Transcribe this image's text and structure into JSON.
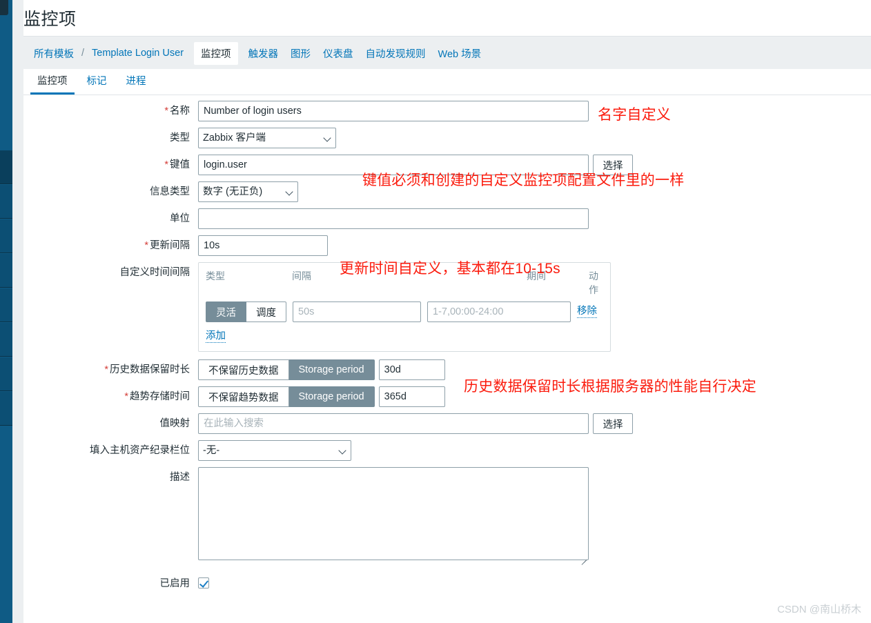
{
  "page": {
    "title": "监控项"
  },
  "breadcrumb": {
    "all_templates": "所有模板",
    "separator": "/",
    "template_name": "Template Login User",
    "tabs": [
      {
        "label": "监控项",
        "active": true
      },
      {
        "label": "触发器",
        "active": false
      },
      {
        "label": "图形",
        "active": false
      },
      {
        "label": "仪表盘",
        "active": false
      },
      {
        "label": "自动发现规则",
        "active": false
      },
      {
        "label": "Web 场景",
        "active": false
      }
    ]
  },
  "subtabs": [
    {
      "label": "监控项",
      "active": true
    },
    {
      "label": "标记",
      "active": false
    },
    {
      "label": "进程",
      "active": false
    }
  ],
  "form": {
    "name": {
      "label": "名称",
      "required": true,
      "value": "Number of login users"
    },
    "type": {
      "label": "类型",
      "required": false,
      "value": "Zabbix 客户端"
    },
    "key": {
      "label": "键值",
      "required": true,
      "value": "login.user",
      "select_button": "选择"
    },
    "info_type": {
      "label": "信息类型",
      "required": false,
      "value": "数字 (无正负)"
    },
    "units": {
      "label": "单位",
      "required": false,
      "value": ""
    },
    "update_interval": {
      "label": "更新间隔",
      "required": true,
      "value": "10s"
    },
    "custom_intervals": {
      "label": "自定义时间间隔",
      "columns": {
        "type": "类型",
        "interval": "间隔",
        "period": "期间",
        "action": "动作"
      },
      "rows": [
        {
          "type_options": [
            "灵活",
            "调度"
          ],
          "type_selected": "灵活",
          "interval_placeholder": "50s",
          "interval_value": "",
          "period_placeholder": "1-7,00:00-24:00",
          "period_value": "",
          "action_label": "移除"
        }
      ],
      "add_label": "添加"
    },
    "history": {
      "label": "历史数据保留时长",
      "required": true,
      "options": [
        "不保留历史数据",
        "Storage period"
      ],
      "selected": "Storage period",
      "value": "30d"
    },
    "trends": {
      "label": "趋势存储时间",
      "required": true,
      "options": [
        "不保留趋势数据",
        "Storage period"
      ],
      "selected": "Storage period",
      "value": "365d"
    },
    "value_map": {
      "label": "值映射",
      "placeholder": "在此输入搜索",
      "value": "",
      "select_button": "选择"
    },
    "inventory_field": {
      "label": "填入主机资产纪录栏位",
      "value": "-无-"
    },
    "description": {
      "label": "描述",
      "value": ""
    },
    "enabled": {
      "label": "已启用",
      "checked": true
    }
  },
  "annotations": [
    {
      "id": "name-note",
      "text": "名字自定义"
    },
    {
      "id": "key-note",
      "text": "键值必须和创建的自定义监控项配置文件里的一样"
    },
    {
      "id": "interval-note",
      "text": "更新时间自定义，基本都在10-15s"
    },
    {
      "id": "history-note",
      "text": "历史数据保留时长根据服务器的性能自行决定"
    }
  ],
  "watermark": {
    "text": "CSDN @南山桥木"
  },
  "colors": {
    "accent": "#0275b8",
    "annotation": "#fb1b0d",
    "toggle_active": "#768d99",
    "sidebar": "#0f5b85",
    "required": "#d43f3a"
  }
}
